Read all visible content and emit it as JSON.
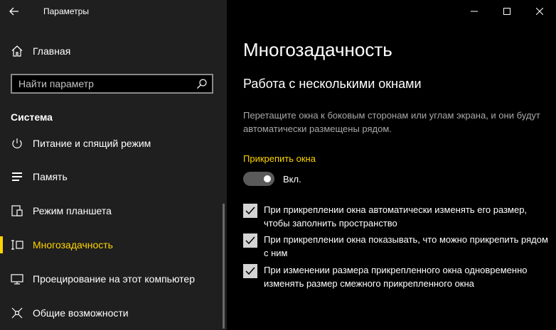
{
  "window": {
    "title": "Параметры"
  },
  "sidebar": {
    "home_label": "Главная",
    "search": {
      "placeholder": "Найти параметр"
    },
    "section_title": "Система",
    "items": [
      {
        "label": "Питание и спящий режим",
        "icon": "power-icon",
        "partial": true
      },
      {
        "label": "Память",
        "icon": "storage-icon"
      },
      {
        "label": "Режим планшета",
        "icon": "tablet-icon"
      },
      {
        "label": "Многозадачность",
        "icon": "multitasking-icon",
        "selected": true
      },
      {
        "label": "Проецирование на этот компьютер",
        "icon": "projecting-icon"
      },
      {
        "label": "Общие возможности",
        "icon": "shared-experiences-icon"
      }
    ]
  },
  "content": {
    "page_title": "Многозадачность",
    "section_title": "Работа с несколькими окнами",
    "description": "Перетащите окна к боковым сторонам или углам экрана, и они будут автоматически размещены рядом.",
    "snap_label": "Прикрепить окна",
    "toggle": {
      "state_label": "Вкл.",
      "on": true
    },
    "checkboxes": [
      {
        "label": "При прикреплении окна автоматически изменять его размер, чтобы заполнить пространство",
        "checked": true
      },
      {
        "label": "При прикреплении окна показывать, что можно прикрепить рядом с ним",
        "checked": true
      },
      {
        "label": "При изменении размера прикрепленного окна одновременно изменять размер смежного прикрепленного окна",
        "checked": true
      }
    ]
  },
  "colors": {
    "accent": "#ffd400",
    "sidebar_bg": "#1f1f1f",
    "content_bg": "#000000"
  }
}
